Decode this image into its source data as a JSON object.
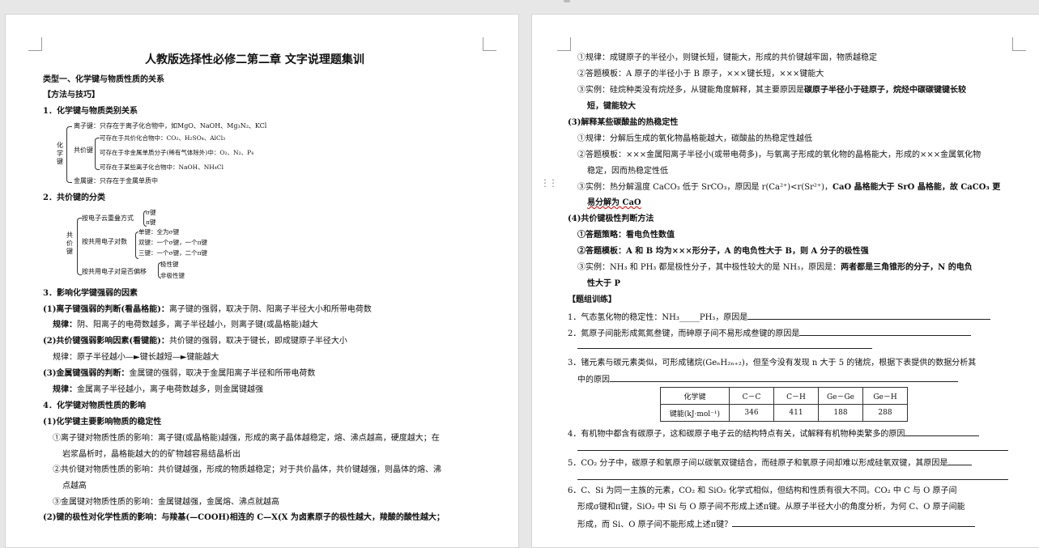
{
  "page1": {
    "title": "人教版选择性必修二第二章 文字说理题集训",
    "section1_heading": "类型一、化学键与物质性质的关系",
    "methods_heading": "【方法与技巧】",
    "h1": "1．化学键与物质类别关系",
    "d1": {
      "root": "化学键",
      "ionic": "离子键：只存在于离子化合物中，如MgO、NaOH、Mg₃N₂、KCl",
      "covalent": "共价键",
      "cov_1": "可存在于共价化合物中：CO₂、H₂SO₄、AlCl₃",
      "cov_2": "可存在于非金属单质分子(稀有气体除外)中：O₂、N₂、P₄",
      "cov_3": "可存在于某些离子化合物中：NaOH、NH₄Cl",
      "metallic": "金属键：只存在于金属单质中"
    },
    "h2": "2．共价键的分类",
    "d2": {
      "root": "共价键",
      "overlap": "按电子云重叠方式",
      "sigma": "σ键",
      "pi": "π键",
      "pairs": "按共用电子对数",
      "single": "单键：全为σ键",
      "double": "双键：一个σ键，一个π键",
      "triple": "三键：一个σ键，二个π键",
      "shift": "按共用电子对是否偏移",
      "polar": "极性键",
      "nonpolar": "非极性键"
    },
    "h3": "3．影响化学键强弱的因素",
    "p1_head": "(1)离子键强弱的判断(看晶格能)：",
    "p1_text": "离子键的强弱，取决于阴、阳离子半径大小和所带电荷数",
    "p1r_head": "规律：",
    "p1r_text": "阴、阳离子的电荷数越多，离子半径越小，则离子键(或晶格能)越大",
    "p2_head": "(2)共价键强弱影响因素(看键能)：",
    "p2_text": "共价键的强弱，取决于键长，即成键原子半径大小",
    "p2r": "规律：原子半径越小—►键长越短—►键能越大",
    "p3_head": "(3)金属键强弱的判断：",
    "p3_text": "金属键的强弱，取决于金属阳离子半径和所带电荷数",
    "p3r_head": "规律：",
    "p3r_text": "金属离子半径越小，离子电荷数越多，则金属键越强",
    "h4": "4．化学键对物质性质的影响",
    "q1_head": "(1)化学键主要影响物质的稳定性",
    "q1a": "①离子键对物质性质的影响：离子键(或晶格能)越强，形成的离子晶体越稳定，熔、沸点越高，硬度越大；在",
    "q1a2": "岩浆晶析时，晶格能越大的的矿物越容易结晶析出",
    "q1b": "②共价键对物质性质的影响：共价键越强，形成的物质越稳定；对于共价晶体，共价键越强，则晶体的熔、沸",
    "q1b2": "点越高",
    "q1c": "③金属键对物质性质的影响：金属键越强，金属熔、沸点就越高",
    "q2": "(2)键的极性对化学性质的影响：与羧基(—COOH)相连的 C—X(X 为卤素原子的极性越大，羧酸的酸性越大；"
  },
  "page2": {
    "r1": "①规律：成键原子的半径小，则键长短，键能大，形成的共价键越牢固，物质越稳定",
    "r2": "②答题模板：A 原子的半径小于 B 原子，×××键长短，×××键能大",
    "r3a": "③实例：硅烷种类没有烷烃多，从键能角度解释，其主要原因是",
    "r3b": "碳原子半径小于硅原子，烷烃中碳碳键键长较",
    "r3c": "短，键能较大",
    "h3": "(3)解释某些碳酸盐的热稳定性",
    "s1": "①规律：分解后生成的氧化物晶格能越大，碳酸盐的热稳定性越低",
    "s2": "②答题模板：×××金属阳离子半径小(或带电荷多)，与氧离子形成的氧化物的晶格能大，形成的×××金属氧化物",
    "s2b": "稳定，因而热稳定性低",
    "s3a": "③实例：热分解温度 CaCO₃ 低于 SrCO₃，原因是 r(Ca²⁺)<r(Sr²⁺)，",
    "s3b": "CaO 晶格能大于 SrO 晶格能，故 CaCO₃ 更",
    "s3c": "易分解为 CaO",
    "h4": "(4)共价键极性判断方法",
    "t1": "①答题策略：看电负性数值",
    "t2": "②答题模板：A 和 B 均为×××形分子，A 的电负性大于 B，则 A 分子的极性强",
    "t3a": "③实例：NH₃ 和 PH₃ 都是极性分子，其中极性较大的是 NH₃，原因是：",
    "t3b": "两者都是三角锥形的分子，N 的电负",
    "t3c": "性大于 P",
    "train": "【题组训练】",
    "e1": "1．气态氢化物的稳定性：NH₃_____PH₃，原因是",
    "e2": "2．氮原子间能形成氮氮叁键，而砷原子间不易形成叁键的原因是",
    "e3a": "3．锗元素与碳元素类似，可形成锗烷(GeₙH₂ₙ₊₂)，但至今没有发现 n 大于 5 的锗烷，根据下表提供的数据分析其",
    "e3b": "中的原因",
    "table": {
      "headers": [
        "化学键",
        "C－C",
        "C－H",
        "Ge－Ge",
        "Ge－H"
      ],
      "row_label": "键能(kJ·mol⁻¹)",
      "values": [
        "346",
        "411",
        "188",
        "288"
      ]
    },
    "e4": "4．有机物中都含有碳原子，这和碳原子电子云的结构特点有关，试解释有机物种类繁多的原因",
    "e5": "5．CO₂ 分子中，碳原子和氧原子间以碳氧双键结合，而硅原子和氧原子间却难以形成硅氧双键，其原因是",
    "e6a": "6．C、Si 为同一主族的元素，CO₂ 和 SiO₂ 化学式相似，但结构和性质有很大不同。CO₂ 中 C 与 O 原子间",
    "e6b": "形成σ键和π键，SiO₂ 中 Si 与 O 原子间不形成上述π键。从原子半径大小的角度分析，为何 C、O 原子间能",
    "e6c": "形成，而 Si、O 原子间不能形成上述π键？"
  }
}
